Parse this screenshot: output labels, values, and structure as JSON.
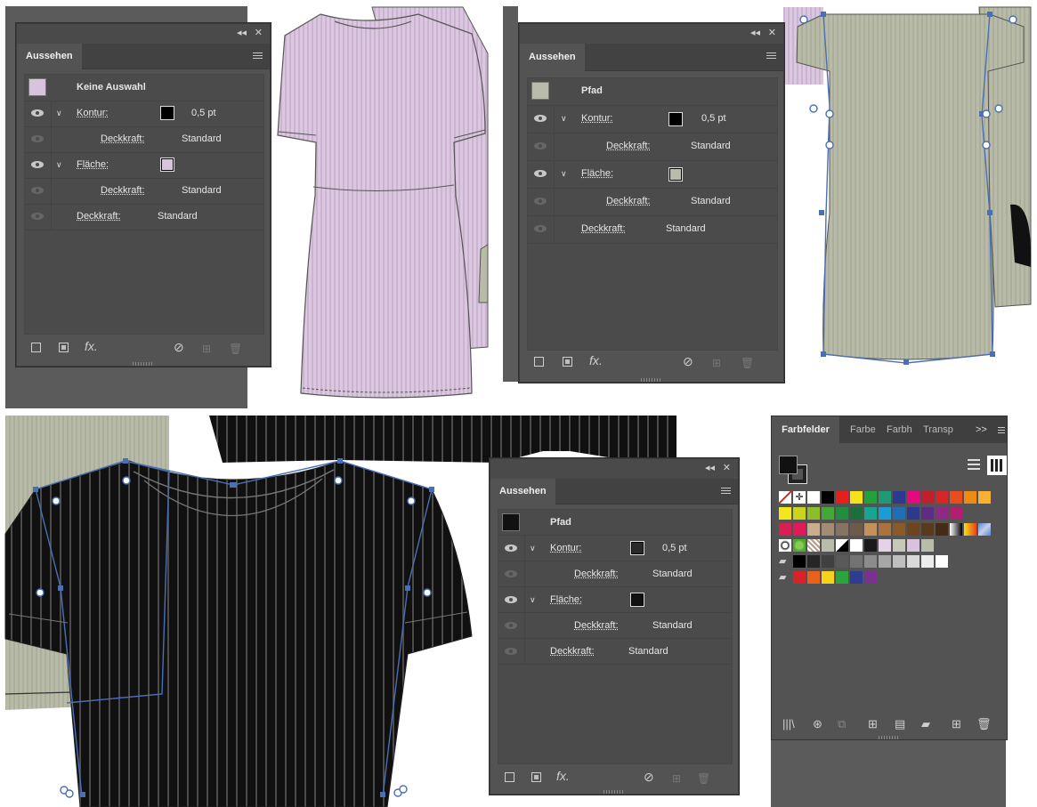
{
  "panels": [
    {
      "id": "top-left",
      "tab": "Aussehen",
      "object_label": "Keine Auswahl",
      "object_swatch": "#d8c3dc",
      "stroke_label": "Kontur:",
      "stroke_weight": "0,5 pt",
      "fill_label": "Fläche:",
      "opacity_label": "Deckkraft:",
      "opacity_value": "Standard",
      "stroke_color": "#000000",
      "fill_color": "#d8c3dc",
      "fx": "fx."
    },
    {
      "id": "top-right",
      "tab": "Aussehen",
      "object_label": "Pfad",
      "object_swatch": "#b9bcaa",
      "stroke_label": "Kontur:",
      "stroke_weight": "0,5 pt",
      "fill_label": "Fläche:",
      "opacity_label": "Deckkraft:",
      "opacity_value": "Standard",
      "stroke_color": "#000000",
      "fill_color": "#b9bcaa",
      "fx": "fx."
    },
    {
      "id": "bottom",
      "tab": "Aussehen",
      "object_label": "Pfad",
      "object_swatch": "#111111",
      "stroke_label": "Kontur:",
      "stroke_weight": "0,5 pt",
      "fill_label": "Fläche:",
      "opacity_label": "Deckkraft:",
      "opacity_value": "Standard",
      "stroke_color": "#2a2a2a",
      "fill_color": "#111111",
      "fx": "fx."
    }
  ],
  "swatches_panel": {
    "tabs": [
      "Farbfelder",
      "Farbe",
      "Farbh",
      "Transp"
    ],
    "more": ">>",
    "rows": [
      [
        "none",
        "reg",
        "#ffffff",
        "#000000",
        "#e3201b",
        "#f5e31a",
        "#23a23c",
        "#1f9a73",
        "#2d3890",
        "#e5097e",
        "#c21f2d",
        "#d6262a",
        "#e84e1b",
        "#ef8a12",
        "#f7b135"
      ],
      [
        "#f3e61a",
        "#c9d41a",
        "#8cbd2a",
        "#45a737",
        "#1f8f3f",
        "#1b6f3b",
        "#17a58f",
        "#1d9bd7",
        "#1f6fb6",
        "#2d3a8c",
        "#5f2c83",
        "#8e2a83",
        "#b0206e"
      ],
      [
        "#d81f53",
        "#e01a5a",
        "#c9ad8c",
        "#a48c74",
        "#877362",
        "#6f5a4a",
        "#c2925a",
        "#a9733f",
        "#8b5a2b",
        "#6c4520",
        "#5a3a1c",
        "#452a14",
        "grad-bw",
        "grad-orange",
        "grad-blue"
      ],
      [
        "pat1",
        "pat2",
        "pat3",
        "#b9bcaa",
        "bwsplit",
        "#ffffff",
        "#1a1a1a",
        "#e4d2e6",
        "#c6c8b8",
        "#d8c3dc",
        "#b9bcaa"
      ],
      [
        "folder",
        "#000000",
        "#262626",
        "#404040",
        "#595959",
        "#737373",
        "#8c8c8c",
        "#a6a6a6",
        "#bfbfbf",
        "#d9d9d9",
        "#ececec",
        "#ffffff"
      ],
      [
        "folder",
        "#d8222a",
        "#e9621c",
        "#f6d31a",
        "#2aa43c",
        "#2d3d93",
        "#7a3290"
      ]
    ]
  },
  "colors": {
    "pink_dress": "#dcc7e0",
    "sage_dress": "#b8bba8",
    "black_tee": "#111111",
    "selection": "#4a6fb5"
  }
}
